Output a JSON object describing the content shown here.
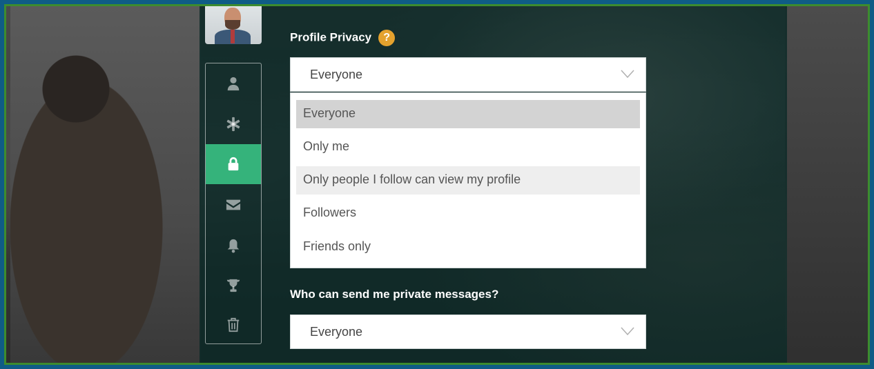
{
  "profile_privacy": {
    "label": "Profile Privacy",
    "help": "?",
    "selected": "Everyone",
    "options": [
      {
        "label": "Everyone",
        "state": "selected"
      },
      {
        "label": "Only me",
        "state": "normal"
      },
      {
        "label": "Only people I follow can view my profile",
        "state": "hover"
      },
      {
        "label": "Followers",
        "state": "normal"
      },
      {
        "label": "Friends only",
        "state": "normal"
      }
    ]
  },
  "private_messages": {
    "label": "Who can send me private messages?",
    "selected": "Everyone"
  },
  "sidebar": {
    "items": [
      {
        "icon": "user-icon"
      },
      {
        "icon": "asterisk-icon"
      },
      {
        "icon": "lock-icon",
        "active": true
      },
      {
        "icon": "envelope-icon"
      },
      {
        "icon": "bell-icon"
      },
      {
        "icon": "trophy-icon"
      },
      {
        "icon": "trash-icon"
      }
    ]
  },
  "colors": {
    "accent": "#35b37b",
    "help_badge": "#e4a22e",
    "panel": "#0a2826"
  }
}
